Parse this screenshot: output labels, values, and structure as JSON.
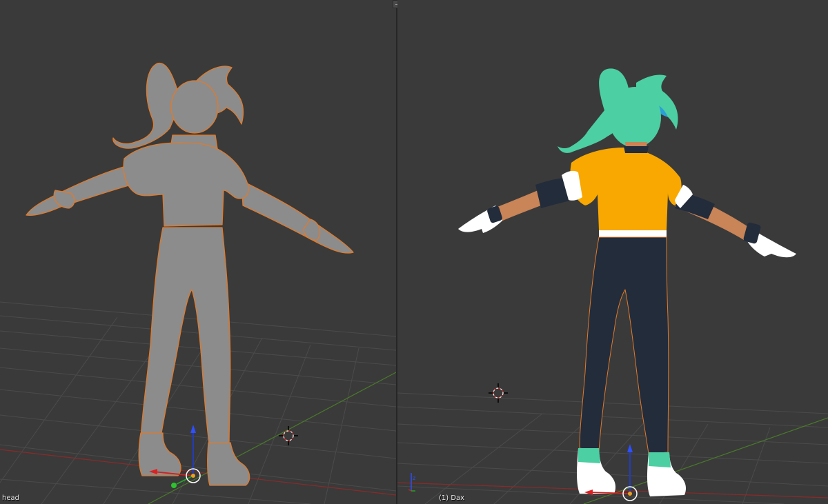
{
  "viewports": {
    "left": {
      "object_label": "head",
      "shading": "solid"
    },
    "right": {
      "object_label": "(1) Dax",
      "shading": "material"
    }
  },
  "colors": {
    "background": "#3a3a3a",
    "grid": "#4b4b4b",
    "axis_x": "#8a2a2a",
    "axis_y": "#4a7a2a",
    "selection_outline": "#e07a2a",
    "clay": "#8c8c8c",
    "hair": "#4ccfa3",
    "jacket": "#f8a800",
    "pants": "#232c3b",
    "skin": "#c98457",
    "gloves": "#ffffff"
  },
  "icons": [
    "3d-cursor-icon",
    "transform-gizmo-icon",
    "axis-indicator-icon",
    "area-split-icon"
  ]
}
